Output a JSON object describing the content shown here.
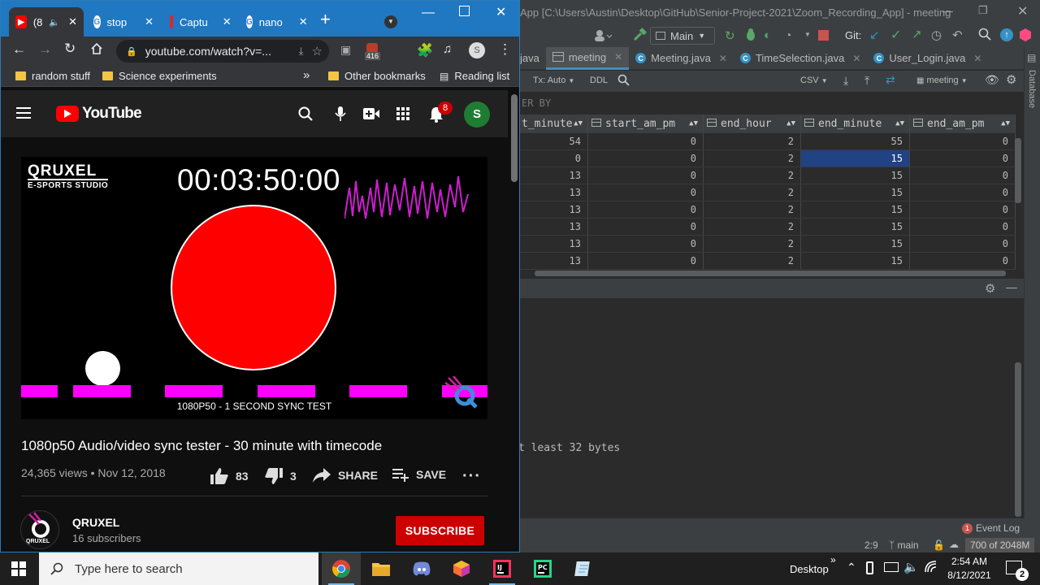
{
  "ide": {
    "title": "App [C:\\Users\\Austin\\Desktop\\GitHub\\Senior-Project-2021\\Zoom_Recording_App] - meeting",
    "toolbar": {
      "branch_selector": "Main",
      "git_label": "Git:"
    },
    "tabs": [
      {
        "label": "java",
        "active": false
      },
      {
        "label": "meeting",
        "active": true
      },
      {
        "label": "Meeting.java",
        "active": false
      },
      {
        "label": "TimeSelection.java",
        "active": false
      },
      {
        "label": "User_Login.java",
        "active": false
      }
    ],
    "subtoolbar": {
      "tx": "Tx: Auto",
      "ddl": "DDL",
      "format": "CSV",
      "schema": "meeting"
    },
    "order_by": "ER BY",
    "grid": {
      "columns": [
        "t_minute",
        "start_am_pm",
        "end_hour",
        "end_minute",
        "end_am_pm"
      ],
      "rows": [
        [
          "54",
          "0",
          "2",
          "55",
          "0"
        ],
        [
          "0",
          "0",
          "2",
          "15",
          "0"
        ],
        [
          "13",
          "0",
          "2",
          "15",
          "0"
        ],
        [
          "13",
          "0",
          "2",
          "15",
          "0"
        ],
        [
          "13",
          "0",
          "2",
          "15",
          "0"
        ],
        [
          "13",
          "0",
          "2",
          "15",
          "0"
        ],
        [
          "13",
          "0",
          "2",
          "15",
          "0"
        ],
        [
          "13",
          "0",
          "2",
          "15",
          "0"
        ]
      ]
    },
    "console_text": "t least 32 bytes",
    "side_panel": "Database",
    "status": {
      "event_log": "Event Log",
      "event_count": "1",
      "position": "2:9",
      "branch": "main",
      "memory": "700 of 2048M"
    }
  },
  "chrome": {
    "tabs": [
      {
        "title": "(8",
        "active": true
      },
      {
        "title": "stop",
        "active": false
      },
      {
        "title": "Captu",
        "active": false
      },
      {
        "title": "nano",
        "active": false
      }
    ],
    "url": "youtube.com/watch?v=...",
    "extension_badge": "416",
    "profile_initial": "S",
    "bookmarks": [
      {
        "label": "random stuff"
      },
      {
        "label": "Science experiments"
      }
    ],
    "bookmarks_overflow": "»",
    "other_bookmarks": "Other bookmarks",
    "reading_list": "Reading list"
  },
  "youtube": {
    "logo_text": "YouTube",
    "notification_count": "8",
    "avatar_initial": "S",
    "player": {
      "brand_line1": "QRUXEL",
      "brand_line2": "E-SPORTS STUDIO",
      "timecode": "00:03:50:00",
      "caption": "1080P50 - 1 SECOND SYNC TEST"
    },
    "video_title": "1080p50 Audio/video sync tester - 30 minute with timecode",
    "meta": "24,365 views • Nov 12, 2018",
    "likes": "83",
    "dislikes": "3",
    "share_label": "SHARE",
    "save_label": "SAVE",
    "channel_name": "QRUXEL",
    "channel_avatar_text": "QRUXEL",
    "subscribers": "16 subscribers",
    "subscribe_label": "SUBSCRIBE"
  },
  "taskbar": {
    "search_placeholder": "Type here to search",
    "desktop_label": "Desktop",
    "time": "2:54 AM",
    "date": "8/12/2021",
    "notification_count": "2"
  },
  "colors": {
    "chrome_tabstrip": "#1f78c1",
    "youtube_red": "#ff0000",
    "subscribe_red": "#cc0000",
    "magenta": "#ff00ff",
    "ide_selection": "#214283"
  }
}
